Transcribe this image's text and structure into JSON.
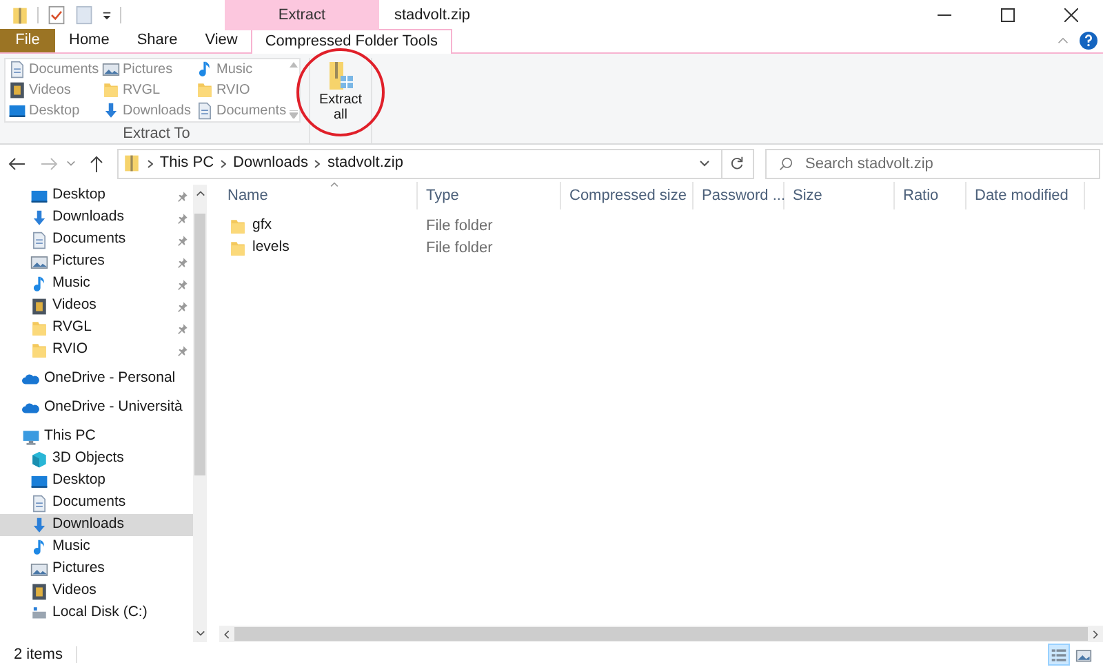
{
  "window": {
    "title": "stadvolt.zip",
    "context_tab": "Extract"
  },
  "ribbon_tabs": [
    {
      "label": "File",
      "kind": "file",
      "selected": false
    },
    {
      "label": "Home",
      "kind": "tab",
      "selected": false
    },
    {
      "label": "Share",
      "kind": "tab",
      "selected": false
    },
    {
      "label": "View",
      "kind": "tab",
      "selected": false
    },
    {
      "label": "Compressed Folder Tools",
      "kind": "tab",
      "selected": true
    }
  ],
  "ribbon": {
    "destinations": [
      {
        "label": "Documents",
        "kind": "documents",
        "disabled": true
      },
      {
        "label": "Pictures",
        "kind": "pictures",
        "disabled": true
      },
      {
        "label": "Music",
        "kind": "music",
        "disabled": true
      },
      {
        "label": "Videos",
        "kind": "videos",
        "disabled": true
      },
      {
        "label": "RVGL",
        "kind": "folder",
        "disabled": true
      },
      {
        "label": "RVIO",
        "kind": "folder",
        "disabled": true
      },
      {
        "label": "Desktop",
        "kind": "desktop",
        "disabled": true
      },
      {
        "label": "Downloads",
        "kind": "downloads",
        "disabled": true
      },
      {
        "label": "Documents",
        "kind": "documents",
        "disabled": true
      }
    ],
    "group_label": "Extract To",
    "extract_all": "Extract all"
  },
  "address": {
    "crumbs": [
      "This PC",
      "Downloads",
      "stadvolt.zip"
    ],
    "search_placeholder": "Search stadvolt.zip"
  },
  "nav": [
    {
      "label": "Desktop",
      "kind": "desktop",
      "pinned": true,
      "selected": false
    },
    {
      "label": "Downloads",
      "kind": "downloads",
      "pinned": true,
      "selected": false
    },
    {
      "label": "Documents",
      "kind": "documents",
      "pinned": true,
      "selected": false
    },
    {
      "label": "Pictures",
      "kind": "pictures",
      "pinned": true,
      "selected": false
    },
    {
      "label": "Music",
      "kind": "music",
      "pinned": true,
      "selected": false
    },
    {
      "label": "Videos",
      "kind": "videos",
      "pinned": true,
      "selected": false
    },
    {
      "label": "RVGL",
      "kind": "folder",
      "pinned": true,
      "selected": false
    },
    {
      "label": "RVIO",
      "kind": "folder",
      "pinned": true,
      "selected": false
    },
    {
      "label": "OneDrive - Personal",
      "kind": "cloud",
      "selected": false
    },
    {
      "label": "OneDrive - Università",
      "kind": "cloud",
      "selected": false
    },
    {
      "label": "This PC",
      "kind": "pc",
      "selected": false,
      "children": [
        {
          "label": "3D Objects",
          "kind": "cube",
          "selected": false
        },
        {
          "label": "Desktop",
          "kind": "desktop",
          "selected": false
        },
        {
          "label": "Documents",
          "kind": "documents",
          "selected": false
        },
        {
          "label": "Downloads",
          "kind": "downloads",
          "selected": true
        },
        {
          "label": "Music",
          "kind": "music",
          "selected": false
        },
        {
          "label": "Pictures",
          "kind": "pictures",
          "selected": false
        },
        {
          "label": "Videos",
          "kind": "videos",
          "selected": false
        },
        {
          "label": "Local Disk (C:)",
          "kind": "drive",
          "selected": false
        }
      ]
    }
  ],
  "table": {
    "columns": [
      "Name",
      "Type",
      "Compressed size",
      "Password ...",
      "Size",
      "Ratio",
      "Date modified"
    ],
    "rows": [
      {
        "name": "gfx",
        "type": "File folder"
      },
      {
        "name": "levels",
        "type": "File folder"
      }
    ]
  },
  "status_bar": {
    "count": "2 items",
    "views": [
      {
        "kind": "details",
        "selected": true
      },
      {
        "kind": "tiles",
        "selected": false
      }
    ]
  }
}
